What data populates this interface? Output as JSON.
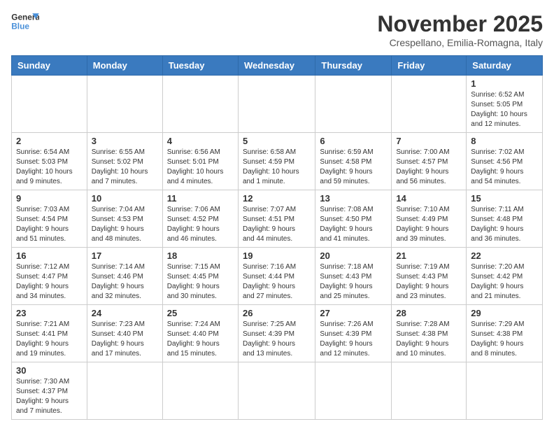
{
  "header": {
    "logo_general": "General",
    "logo_blue": "Blue",
    "month_title": "November 2025",
    "location": "Crespellano, Emilia-Romagna, Italy"
  },
  "days_of_week": [
    "Sunday",
    "Monday",
    "Tuesday",
    "Wednesday",
    "Thursday",
    "Friday",
    "Saturday"
  ],
  "weeks": [
    [
      {
        "day": "",
        "info": ""
      },
      {
        "day": "",
        "info": ""
      },
      {
        "day": "",
        "info": ""
      },
      {
        "day": "",
        "info": ""
      },
      {
        "day": "",
        "info": ""
      },
      {
        "day": "",
        "info": ""
      },
      {
        "day": "1",
        "info": "Sunrise: 6:52 AM\nSunset: 5:05 PM\nDaylight: 10 hours\nand 12 minutes."
      }
    ],
    [
      {
        "day": "2",
        "info": "Sunrise: 6:54 AM\nSunset: 5:03 PM\nDaylight: 10 hours\nand 9 minutes."
      },
      {
        "day": "3",
        "info": "Sunrise: 6:55 AM\nSunset: 5:02 PM\nDaylight: 10 hours\nand 7 minutes."
      },
      {
        "day": "4",
        "info": "Sunrise: 6:56 AM\nSunset: 5:01 PM\nDaylight: 10 hours\nand 4 minutes."
      },
      {
        "day": "5",
        "info": "Sunrise: 6:58 AM\nSunset: 4:59 PM\nDaylight: 10 hours\nand 1 minute."
      },
      {
        "day": "6",
        "info": "Sunrise: 6:59 AM\nSunset: 4:58 PM\nDaylight: 9 hours\nand 59 minutes."
      },
      {
        "day": "7",
        "info": "Sunrise: 7:00 AM\nSunset: 4:57 PM\nDaylight: 9 hours\nand 56 minutes."
      },
      {
        "day": "8",
        "info": "Sunrise: 7:02 AM\nSunset: 4:56 PM\nDaylight: 9 hours\nand 54 minutes."
      }
    ],
    [
      {
        "day": "9",
        "info": "Sunrise: 7:03 AM\nSunset: 4:54 PM\nDaylight: 9 hours\nand 51 minutes."
      },
      {
        "day": "10",
        "info": "Sunrise: 7:04 AM\nSunset: 4:53 PM\nDaylight: 9 hours\nand 48 minutes."
      },
      {
        "day": "11",
        "info": "Sunrise: 7:06 AM\nSunset: 4:52 PM\nDaylight: 9 hours\nand 46 minutes."
      },
      {
        "day": "12",
        "info": "Sunrise: 7:07 AM\nSunset: 4:51 PM\nDaylight: 9 hours\nand 44 minutes."
      },
      {
        "day": "13",
        "info": "Sunrise: 7:08 AM\nSunset: 4:50 PM\nDaylight: 9 hours\nand 41 minutes."
      },
      {
        "day": "14",
        "info": "Sunrise: 7:10 AM\nSunset: 4:49 PM\nDaylight: 9 hours\nand 39 minutes."
      },
      {
        "day": "15",
        "info": "Sunrise: 7:11 AM\nSunset: 4:48 PM\nDaylight: 9 hours\nand 36 minutes."
      }
    ],
    [
      {
        "day": "16",
        "info": "Sunrise: 7:12 AM\nSunset: 4:47 PM\nDaylight: 9 hours\nand 34 minutes."
      },
      {
        "day": "17",
        "info": "Sunrise: 7:14 AM\nSunset: 4:46 PM\nDaylight: 9 hours\nand 32 minutes."
      },
      {
        "day": "18",
        "info": "Sunrise: 7:15 AM\nSunset: 4:45 PM\nDaylight: 9 hours\nand 30 minutes."
      },
      {
        "day": "19",
        "info": "Sunrise: 7:16 AM\nSunset: 4:44 PM\nDaylight: 9 hours\nand 27 minutes."
      },
      {
        "day": "20",
        "info": "Sunrise: 7:18 AM\nSunset: 4:43 PM\nDaylight: 9 hours\nand 25 minutes."
      },
      {
        "day": "21",
        "info": "Sunrise: 7:19 AM\nSunset: 4:43 PM\nDaylight: 9 hours\nand 23 minutes."
      },
      {
        "day": "22",
        "info": "Sunrise: 7:20 AM\nSunset: 4:42 PM\nDaylight: 9 hours\nand 21 minutes."
      }
    ],
    [
      {
        "day": "23",
        "info": "Sunrise: 7:21 AM\nSunset: 4:41 PM\nDaylight: 9 hours\nand 19 minutes."
      },
      {
        "day": "24",
        "info": "Sunrise: 7:23 AM\nSunset: 4:40 PM\nDaylight: 9 hours\nand 17 minutes."
      },
      {
        "day": "25",
        "info": "Sunrise: 7:24 AM\nSunset: 4:40 PM\nDaylight: 9 hours\nand 15 minutes."
      },
      {
        "day": "26",
        "info": "Sunrise: 7:25 AM\nSunset: 4:39 PM\nDaylight: 9 hours\nand 13 minutes."
      },
      {
        "day": "27",
        "info": "Sunrise: 7:26 AM\nSunset: 4:39 PM\nDaylight: 9 hours\nand 12 minutes."
      },
      {
        "day": "28",
        "info": "Sunrise: 7:28 AM\nSunset: 4:38 PM\nDaylight: 9 hours\nand 10 minutes."
      },
      {
        "day": "29",
        "info": "Sunrise: 7:29 AM\nSunset: 4:38 PM\nDaylight: 9 hours\nand 8 minutes."
      }
    ],
    [
      {
        "day": "30",
        "info": "Sunrise: 7:30 AM\nSunset: 4:37 PM\nDaylight: 9 hours\nand 7 minutes."
      },
      {
        "day": "",
        "info": ""
      },
      {
        "day": "",
        "info": ""
      },
      {
        "day": "",
        "info": ""
      },
      {
        "day": "",
        "info": ""
      },
      {
        "day": "",
        "info": ""
      },
      {
        "day": "",
        "info": ""
      }
    ]
  ]
}
